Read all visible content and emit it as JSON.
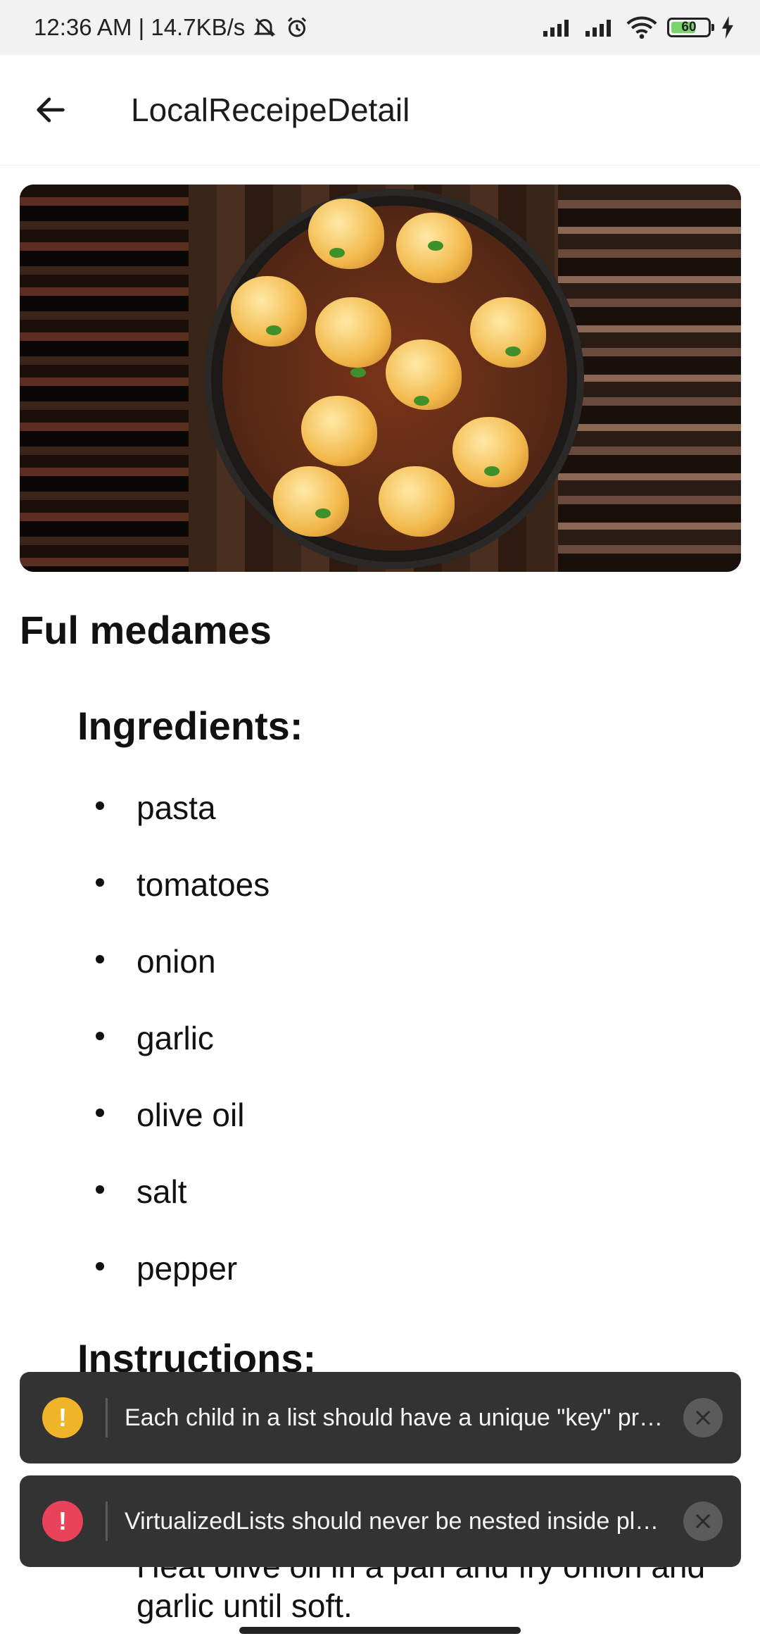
{
  "status_bar": {
    "time_speed": "12:36 AM | 14.7KB/s",
    "battery_level": "60",
    "icons": [
      "mute-bell-icon",
      "alarm-icon",
      "signal-icon",
      "signal-icon",
      "wifi-icon",
      "battery-icon",
      "charging-icon"
    ]
  },
  "header": {
    "title": "LocalReceipeDetail",
    "back_icon": "arrow-left-icon"
  },
  "recipe": {
    "name": "Ful medames",
    "ingredients_heading": "Ingredients:",
    "ingredients": [
      "pasta",
      "tomatoes",
      "onion",
      "garlic",
      "olive oil",
      "salt",
      "pepper"
    ],
    "instructions_heading": "Instructions:",
    "instruction_visible": "Heat olive oil in a pan and fry onion and garlic until soft."
  },
  "toasts": [
    {
      "icon": "warning-icon",
      "symbol": "!",
      "color": "#f0b429",
      "message": "Each child in a list should have a unique \"key\" prop..."
    },
    {
      "icon": "error-icon",
      "symbol": "!",
      "color": "#e8435a",
      "message": "VirtualizedLists should never be nested inside plai..."
    }
  ],
  "colors": {
    "toast_bg": "#333333",
    "status_bar_bg": "#f2f2f2"
  }
}
